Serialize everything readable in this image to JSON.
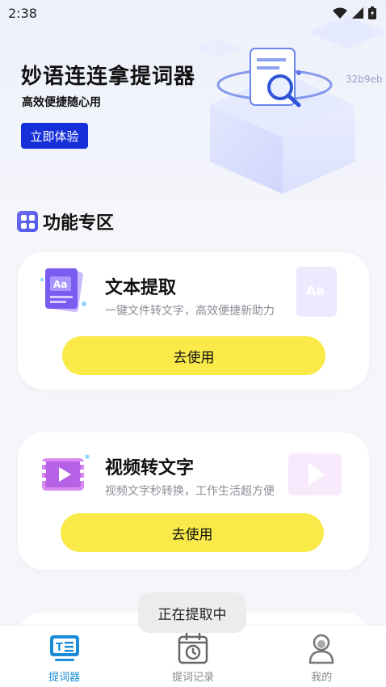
{
  "status_bar": {
    "time": "2:38"
  },
  "hero": {
    "title": "妙语连连拿提词器",
    "subtitle": "高效便捷随心用",
    "cta_label": "立即体验",
    "id_text": "32b9eb"
  },
  "section": {
    "title": "功能专区"
  },
  "cards": [
    {
      "title": "文本提取",
      "description": "一键文件转文字，高效便捷新助力",
      "button_label": "去使用"
    },
    {
      "title": "视频转文字",
      "description": "视频文字秒转换，工作生活超方便",
      "button_label": "去使用"
    }
  ],
  "toast": {
    "text": "正在提取中"
  },
  "tabs": [
    {
      "label": "提词器",
      "icon": "teleprompter-icon",
      "active": true
    },
    {
      "label": "提词记录",
      "icon": "history-calendar-icon",
      "active": false
    },
    {
      "label": "我的",
      "icon": "profile-icon",
      "active": false
    }
  ],
  "colors": {
    "accent_blue": "#1530d8",
    "button_yellow": "#f9ea4a",
    "active_tab": "#1a8dd6",
    "section_icon": "#5b5fe9"
  }
}
